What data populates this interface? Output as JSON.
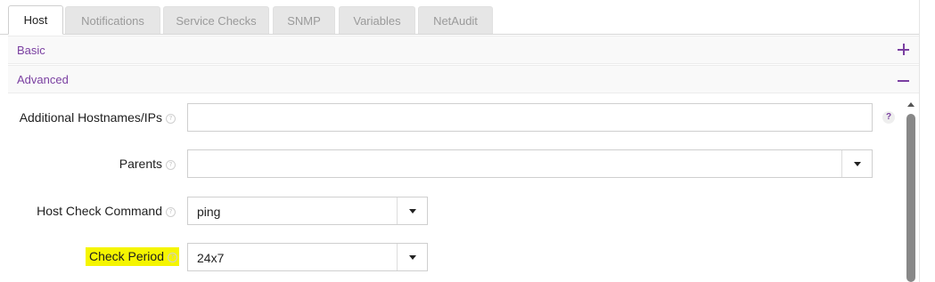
{
  "tabs": [
    {
      "label": "Host",
      "active": true
    },
    {
      "label": "Notifications",
      "active": false
    },
    {
      "label": "Service Checks",
      "active": false
    },
    {
      "label": "SNMP",
      "active": false
    },
    {
      "label": "Variables",
      "active": false
    },
    {
      "label": "NetAudit",
      "active": false
    }
  ],
  "sections": {
    "basic": {
      "label": "Basic",
      "state": "collapsed"
    },
    "advanced": {
      "label": "Advanced",
      "state": "expanded"
    }
  },
  "form": {
    "additional_hostnames": {
      "label": "Additional Hostnames/IPs",
      "value": "",
      "help": "?"
    },
    "parents": {
      "label": "Parents",
      "value": ""
    },
    "host_check_command": {
      "label": "Host Check Command",
      "value": "ping"
    },
    "check_period": {
      "label": "Check Period",
      "value": "24x7",
      "highlight_color": "#f5f500"
    }
  },
  "colors": {
    "accent": "#7a3fa1",
    "tab_inactive": "#e6e6e6"
  }
}
